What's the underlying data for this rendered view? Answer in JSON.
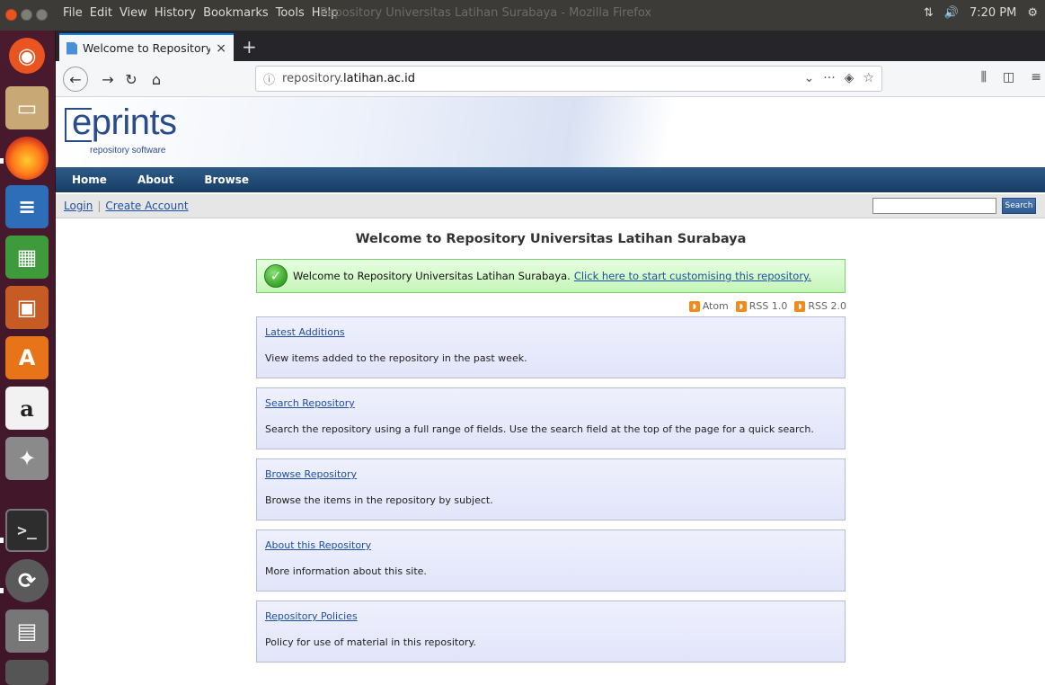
{
  "topbar": {
    "menus": [
      "File",
      "Edit",
      "View",
      "History",
      "Bookmarks",
      "Tools",
      "Help"
    ],
    "window_title": "Repository Universitas Latihan Surabaya - Mozilla Firefox",
    "time": "7:20 PM"
  },
  "browser": {
    "tab_title": "Welcome to Repository Un",
    "tab_close": "×",
    "new_tab": "+",
    "url_prefix": "repository.",
    "url_domain": "latihan.ac.id"
  },
  "eprints": {
    "logo_text": "eprints",
    "logo_sub": "repository software",
    "nav": [
      "Home",
      "About",
      "Browse"
    ],
    "login": "Login",
    "create_account": "Create Account",
    "search_button": "Search",
    "search_value": "",
    "page_title": "Welcome to Repository Universitas Latihan Surabaya",
    "welcome_message": "Welcome to Repository Universitas Latihan Surabaya.",
    "welcome_link": "Click here to start customising this repository.",
    "feeds": [
      "Atom",
      "RSS 1.0",
      "RSS 2.0"
    ],
    "boxes": [
      {
        "link": "Latest Additions",
        "desc": "View items added to the repository in the past week."
      },
      {
        "link": "Search Repository",
        "desc": "Search the repository using a full range of fields. Use the search field at the top of the page for a quick search."
      },
      {
        "link": "Browse Repository",
        "desc": "Browse the items in the repository by subject."
      },
      {
        "link": "About this Repository",
        "desc": "More information about this site."
      },
      {
        "link": "Repository Policies",
        "desc": "Policy for use of material in this repository."
      }
    ]
  },
  "colors": {
    "ubuntu_panel": "#3c3b37",
    "launcher": "#4a1a2f",
    "eprints_nav": "#1f4a74",
    "link": "#1d50a3",
    "success_green": "#c6f5b8"
  }
}
